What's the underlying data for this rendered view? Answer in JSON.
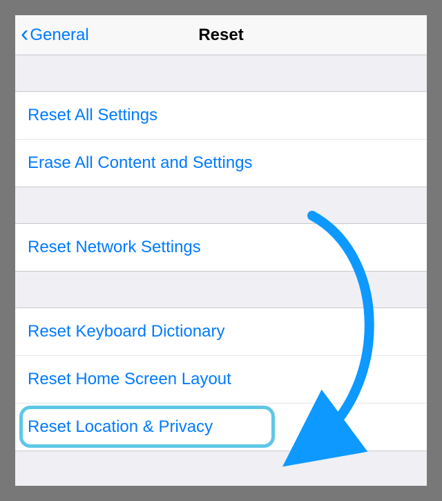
{
  "navbar": {
    "back_label": "General",
    "title": "Reset"
  },
  "groups": [
    {
      "rows": [
        {
          "label": "Reset All Settings",
          "key": "reset-all-settings"
        },
        {
          "label": "Erase All Content and Settings",
          "key": "erase-all-content"
        }
      ]
    },
    {
      "rows": [
        {
          "label": "Reset Network Settings",
          "key": "reset-network-settings"
        }
      ]
    },
    {
      "rows": [
        {
          "label": "Reset Keyboard Dictionary",
          "key": "reset-keyboard-dictionary"
        },
        {
          "label": "Reset Home Screen Layout",
          "key": "reset-home-screen-layout"
        },
        {
          "label": "Reset Location & Privacy",
          "key": "reset-location-privacy",
          "highlighted": true
        }
      ]
    }
  ],
  "colors": {
    "link": "#007aff",
    "highlight_ring": "#5ec7e8",
    "arrow": "#0d99ff",
    "background": "#efeff4",
    "cell": "#ffffff",
    "separator": "#c8c7cc"
  },
  "annotation": {
    "arrow_target": "reset-location-privacy"
  }
}
